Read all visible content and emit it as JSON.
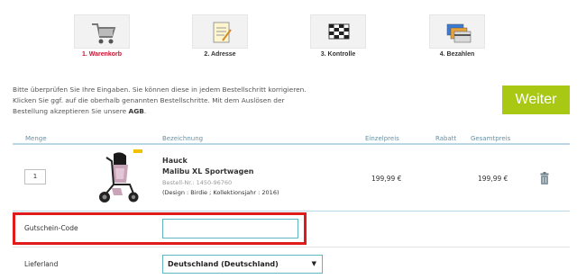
{
  "steps": [
    {
      "label": "1. Warenkorb",
      "icon": "shopping-cart-icon",
      "active": true
    },
    {
      "label": "2. Adresse",
      "icon": "notepad-icon",
      "active": false
    },
    {
      "label": "3. Kontrolle",
      "icon": "checkered-flag-icon",
      "active": false
    },
    {
      "label": "4. Bezahlen",
      "icon": "credit-cards-icon",
      "active": false
    }
  ],
  "intro": {
    "text": "Bitte überprüfen Sie Ihre Eingaben. Sie können diese in jedem Bestellschritt korrigieren. Klicken Sie ggf. auf die oberhalb genannten Bestellschritte. Mit dem Auslösen der Bestellung akzeptieren Sie unsere",
    "agb": "AGB",
    "period": "."
  },
  "weiter_label": "Weiter",
  "table": {
    "headers": {
      "menge": "Menge",
      "bezeichnung": "Bezeichnung",
      "einzelpreis": "Einzelpreis",
      "rabatt": "Rabatt",
      "gesamtpreis": "Gesamtpreis"
    }
  },
  "item": {
    "quantity": "1",
    "brand": "Hauck",
    "name": "Malibu XL Sportwagen",
    "article_no": "Bestell-Nr.: 1450-96760",
    "design": "(Design : Birdie ; Kollektionsjahr : 2016)",
    "unit_price": "199,99 €",
    "total_price": "199,99 €"
  },
  "voucher": {
    "label": "Gutschein-Code",
    "value": "",
    "placeholder": ""
  },
  "country": {
    "label": "Lieferland",
    "selected": "Deutschland (Deutschland)"
  },
  "colors": {
    "accent_green": "#a8c814",
    "active_step_red": "#c8102e",
    "highlight_red": "#e01b1b",
    "table_line": "#b9d7e6",
    "input_border": "#5fb7c4"
  }
}
